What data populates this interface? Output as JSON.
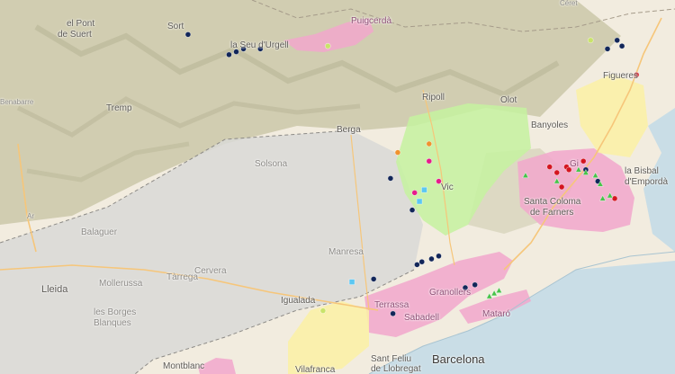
{
  "map": {
    "colors": {
      "land": "#f2ecdf",
      "sea": "#c9dde6",
      "mountain": "#c9c6a8",
      "grey_zone": "#d6d6d6",
      "pink_zone": "#f2a7cd",
      "green_zone": "#c6f2a0",
      "yellow_zone": "#fbf1a5",
      "road": "#f6c67a",
      "marker_navy": "#122659",
      "marker_orange": "#f0922e",
      "marker_magenta": "#e61c8c",
      "marker_red": "#d4151f",
      "marker_green": "#46c34a",
      "marker_cyan": "#5cc7f2",
      "marker_yellowgreen": "#c9e36a"
    },
    "labels": {
      "el_pont": "el Pont",
      "de_suert": "de Suert",
      "sort": "Sort",
      "la_seu": "la Seu d'Urgell",
      "puigcerda": "Puigcerdà",
      "ceret": "Céret",
      "benabarre": "Benabarre",
      "tremp": "Tremp",
      "ripoll": "Ripoll",
      "olot": "Olot",
      "figueres": "Figueres",
      "berga": "Berga",
      "banyoles": "Banyoles",
      "solsona": "Solsona",
      "girona": "Gi",
      "la_bisbal": "la Bisbal",
      "emporda": "d'Empordà",
      "vic": "Vic",
      "santa_coloma": "Santa Coloma",
      "farners": "de Farners",
      "balaguer": "Balaguer",
      "manresa": "Manresa",
      "cervera": "Cervera",
      "tarrega": "Tàrrega",
      "mollerussa": "Mollerussa",
      "lleida": "Lleida",
      "les_borges": "les Borges",
      "blanques": "Blanques",
      "igualada": "Igualada",
      "terrassa": "Terrassa",
      "granollers": "Granollers",
      "sabadell": "Sabadell",
      "mataro": "Mataró",
      "montblanc": "Montblanc",
      "vilafranca": "Vilafranca",
      "sant_feliu": "Sant Feliu",
      "de_llobregat": "de Llobregat",
      "barcelona": "Barcelona",
      "ar": "Ar"
    },
    "markers": [
      {
        "color": "navy",
        "lng": 1.28,
        "lat": 42.43
      },
      {
        "color": "navy",
        "lng": 1.45,
        "lat": 42.36
      },
      {
        "color": "navy",
        "lng": 1.48,
        "lat": 42.37
      },
      {
        "color": "navy",
        "lng": 1.51,
        "lat": 42.38
      },
      {
        "color": "navy",
        "lng": 1.58,
        "lat": 42.38
      },
      {
        "color": "navy",
        "lng": 3.02,
        "lat": 42.38
      },
      {
        "color": "navy",
        "lng": 3.06,
        "lat": 42.41
      },
      {
        "color": "navy",
        "lng": 3.08,
        "lat": 42.39
      },
      {
        "color": "navy",
        "lng": 2.12,
        "lat": 41.93
      },
      {
        "color": "navy",
        "lng": 2.21,
        "lat": 41.82
      },
      {
        "color": "navy",
        "lng": 2.05,
        "lat": 41.58
      },
      {
        "color": "navy",
        "lng": 2.23,
        "lat": 41.63
      },
      {
        "color": "navy",
        "lng": 2.25,
        "lat": 41.64
      },
      {
        "color": "navy",
        "lng": 2.29,
        "lat": 41.65
      },
      {
        "color": "navy",
        "lng": 2.32,
        "lat": 41.66
      },
      {
        "color": "navy",
        "lng": 2.43,
        "lat": 41.55
      },
      {
        "color": "navy",
        "lng": 2.47,
        "lat": 41.56
      },
      {
        "color": "navy",
        "lng": 2.13,
        "lat": 41.46
      },
      {
        "color": "navy",
        "lng": 2.93,
        "lat": 41.96
      },
      {
        "color": "navy",
        "lng": 2.98,
        "lat": 41.92
      },
      {
        "color": "orange",
        "lng": 2.15,
        "lat": 42.02
      },
      {
        "color": "orange",
        "lng": 2.28,
        "lat": 42.05
      },
      {
        "color": "magenta",
        "lng": 2.28,
        "lat": 41.99
      },
      {
        "color": "magenta",
        "lng": 2.32,
        "lat": 41.92
      },
      {
        "color": "magenta",
        "lng": 2.22,
        "lat": 41.88
      },
      {
        "color": "red",
        "lng": 2.78,
        "lat": 41.97
      },
      {
        "color": "red",
        "lng": 2.81,
        "lat": 41.95
      },
      {
        "color": "red",
        "lng": 2.85,
        "lat": 41.97
      },
      {
        "color": "red",
        "lng": 2.86,
        "lat": 41.96
      },
      {
        "color": "red",
        "lng": 2.92,
        "lat": 41.99
      },
      {
        "color": "red",
        "lng": 2.83,
        "lat": 41.9
      },
      {
        "color": "red",
        "lng": 3.05,
        "lat": 41.86
      },
      {
        "color": "red",
        "lng": 3.14,
        "lat": 42.29
      },
      {
        "color": "cyan",
        "lng": 2.26,
        "lat": 41.89
      },
      {
        "color": "cyan",
        "lng": 2.24,
        "lat": 41.85
      },
      {
        "color": "cyan",
        "lng": 1.96,
        "lat": 41.57
      },
      {
        "color": "yellowgreen",
        "lng": 1.86,
        "lat": 42.39
      },
      {
        "color": "yellowgreen",
        "lng": 2.95,
        "lat": 42.41
      },
      {
        "color": "yellowgreen",
        "lng": 1.84,
        "lat": 41.47
      },
      {
        "color": "green",
        "lng": 2.9,
        "lat": 41.96
      },
      {
        "color": "green",
        "lng": 2.93,
        "lat": 41.95
      },
      {
        "color": "green",
        "lng": 2.97,
        "lat": 41.94
      },
      {
        "color": "green",
        "lng": 2.81,
        "lat": 41.92
      },
      {
        "color": "green",
        "lng": 2.68,
        "lat": 41.94
      },
      {
        "color": "green",
        "lng": 3.03,
        "lat": 41.87
      },
      {
        "color": "green",
        "lng": 3.0,
        "lat": 41.86
      },
      {
        "color": "green",
        "lng": 2.99,
        "lat": 41.91
      },
      {
        "color": "green",
        "lng": 2.53,
        "lat": 41.52
      },
      {
        "color": "green",
        "lng": 2.55,
        "lat": 41.53
      },
      {
        "color": "green",
        "lng": 2.57,
        "lat": 41.54
      }
    ]
  }
}
